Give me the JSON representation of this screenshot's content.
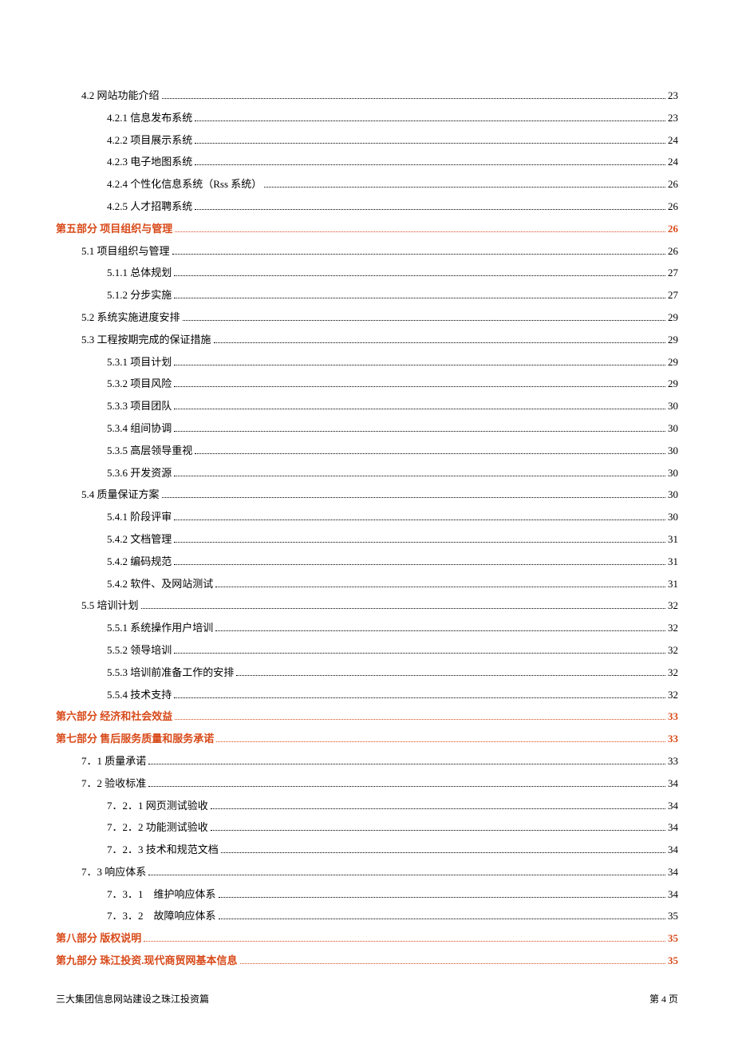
{
  "toc": [
    {
      "level": 1,
      "part": false,
      "label": "4.2 网站功能介绍",
      "page": "23"
    },
    {
      "level": 2,
      "part": false,
      "label": "4.2.1 信息发布系统",
      "page": "23"
    },
    {
      "level": 2,
      "part": false,
      "label": "4.2.2 项目展示系统",
      "page": "24"
    },
    {
      "level": 2,
      "part": false,
      "label": "4.2.3  电子地图系统",
      "page": "24"
    },
    {
      "level": 2,
      "part": false,
      "label": "4.2.4 个性化信息系统（Rss 系统）",
      "page": "26"
    },
    {
      "level": 2,
      "part": false,
      "label": "4.2.5  人才招聘系统",
      "page": "26"
    },
    {
      "level": 0,
      "part": true,
      "label": "第五部分  项目组织与管理",
      "page": "26"
    },
    {
      "level": 1,
      "part": false,
      "label": "5.1  项目组织与管理",
      "page": "26"
    },
    {
      "level": 2,
      "part": false,
      "label": "5.1.1 总体规划",
      "page": "27"
    },
    {
      "level": 2,
      "part": false,
      "label": "5.1.2  分步实施",
      "page": "27"
    },
    {
      "level": 1,
      "part": false,
      "label": "5.2 系统实施进度安排",
      "page": "29"
    },
    {
      "level": 1,
      "part": false,
      "label": "5.3  工程按期完成的保证措施",
      "page": "29"
    },
    {
      "level": 2,
      "part": false,
      "label": "5.3.1 项目计划",
      "page": "29"
    },
    {
      "level": 2,
      "part": false,
      "label": "5.3.2 项目风险",
      "page": "29"
    },
    {
      "level": 2,
      "part": false,
      "label": "5.3.3 项目团队",
      "page": "30"
    },
    {
      "level": 2,
      "part": false,
      "label": "5.3.4 组间协调",
      "page": "30"
    },
    {
      "level": 2,
      "part": false,
      "label": "5.3.5 高层领导重视",
      "page": "30"
    },
    {
      "level": 2,
      "part": false,
      "label": "5.3.6 开发资源",
      "page": "30"
    },
    {
      "level": 1,
      "part": false,
      "label": "5.4  质量保证方案",
      "page": "30"
    },
    {
      "level": 2,
      "part": false,
      "label": "5.4.1 阶段评审",
      "page": "30"
    },
    {
      "level": 2,
      "part": false,
      "label": "5.4.2  文档管理",
      "page": "31"
    },
    {
      "level": 2,
      "part": false,
      "label": "5.4.2  编码规范",
      "page": "31"
    },
    {
      "level": 2,
      "part": false,
      "label": "5.4.2 软件、及网站测试",
      "page": "31"
    },
    {
      "level": 1,
      "part": false,
      "label": "5.5 培训计划",
      "page": "32"
    },
    {
      "level": 2,
      "part": false,
      "label": "5.5.1 系统操作用户培训",
      "page": "32"
    },
    {
      "level": 2,
      "part": false,
      "label": "5.5.2 领导培训",
      "page": "32"
    },
    {
      "level": 2,
      "part": false,
      "label": "5.5.3 培训前准备工作的安排",
      "page": "32"
    },
    {
      "level": 2,
      "part": false,
      "label": "5.5.4 技术支持",
      "page": "32"
    },
    {
      "level": 0,
      "part": true,
      "label": "第六部分  经济和社会效益",
      "page": "33"
    },
    {
      "level": 0,
      "part": true,
      "label": "第七部分  售后服务质量和服务承诺",
      "page": "33"
    },
    {
      "level": 1,
      "part": false,
      "label": "7．1 质量承诺",
      "page": "33"
    },
    {
      "level": 1,
      "part": false,
      "label": "7．2 验收标准",
      "page": "34"
    },
    {
      "level": 2,
      "part": false,
      "label": "7．2．1 网页测试验收",
      "page": "34"
    },
    {
      "level": 2,
      "part": false,
      "label": "7．2．2 功能测试验收",
      "page": "34"
    },
    {
      "level": 2,
      "part": false,
      "label": "7．2．3 技术和规范文档",
      "page": "34"
    },
    {
      "level": 1,
      "part": false,
      "label": "7．3 响应体系",
      "page": "34"
    },
    {
      "level": 2,
      "part": false,
      "label": "7．3．1　维护响应体系",
      "page": "34"
    },
    {
      "level": 2,
      "part": false,
      "label": "7．3．2　故障响应体系",
      "page": "35"
    },
    {
      "level": 0,
      "part": true,
      "label": "第八部分  版权说明",
      "page": "35"
    },
    {
      "level": 0,
      "part": true,
      "label": "第九部分  珠江投资.现代商贸网基本信息",
      "page": "35"
    }
  ],
  "footer": {
    "left": "三大集团信息网站建设之珠江投资篇",
    "right": "第 4 页"
  }
}
